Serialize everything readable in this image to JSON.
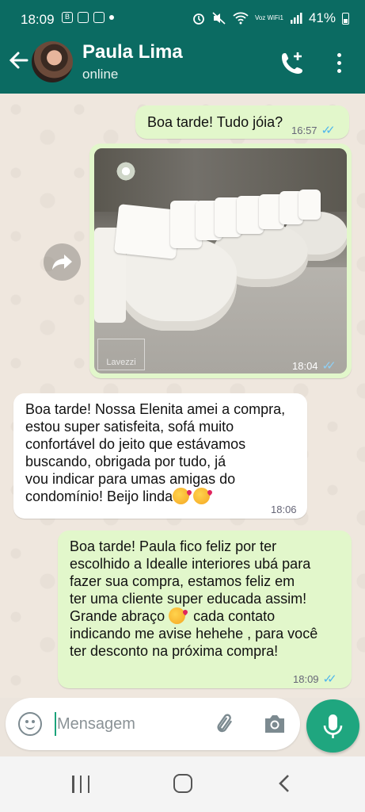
{
  "status_bar": {
    "time": "18:09",
    "battery": "41%",
    "volte": "Voz WiFi1"
  },
  "header": {
    "contact_name": "Paula Lima",
    "contact_status": "online"
  },
  "messages": [
    {
      "direction": "outgoing",
      "text": "Boa tarde! Tudo jóia?",
      "time": "16:57",
      "read": true
    },
    {
      "direction": "outgoing",
      "type": "image",
      "image_watermark": "Lavezzi",
      "time": "18:04",
      "read": true
    },
    {
      "direction": "incoming",
      "lines": [
        "Boa tarde! Nossa Elenita amei a compra,",
        "estou super satisfeita, sofá muito",
        "confortável do jeito que estávamos",
        "buscando, obrigada por tudo, já",
        "vou indicar para umas amigas do",
        "condomínio! Beijo linda"
      ],
      "time": "18:06"
    },
    {
      "direction": "outgoing",
      "lines": [
        "Boa tarde! Paula fico feliz por ter",
        "escolhido a Idealle interiores ubá para",
        "fazer sua compra,  estamos feliz em",
        "ter uma cliente super educada assim!",
        "Grande abraço",
        "  cada contato",
        "indicando me avise hehehe , para você",
        "ter desconto na próxima compra!"
      ],
      "time": "18:09",
      "read": true
    }
  ],
  "composer": {
    "placeholder": "Mensagem"
  },
  "colors": {
    "header": "#0b6b62",
    "outgoing_bubble": "#e2f7cb",
    "incoming_bubble": "#ffffff",
    "accent": "#1fa67f",
    "read_ticks": "#4fb6ec"
  },
  "icons": {
    "back": "arrow-left-icon",
    "add_call": "phone-plus-icon",
    "menu": "more-vertical-icon",
    "share": "forward-icon",
    "emoji": "emoji-icon",
    "attach": "paperclip-icon",
    "camera": "camera-icon",
    "mic": "microphone-icon"
  }
}
